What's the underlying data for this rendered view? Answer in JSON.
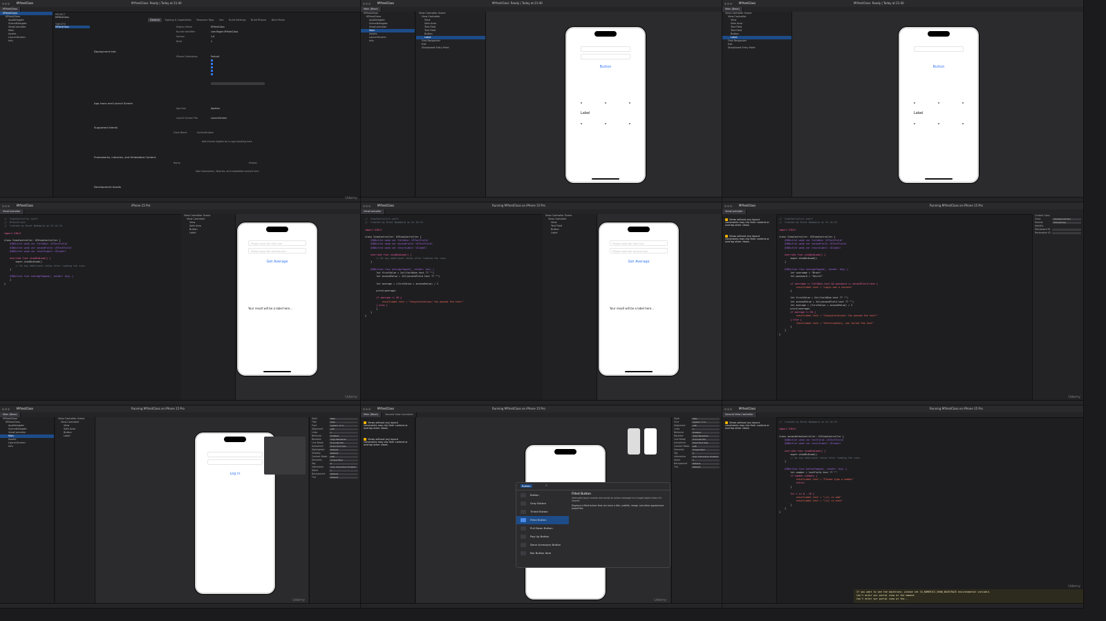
{
  "project": "MYtestClass",
  "watermark": "Udemy",
  "toolbar": {
    "title": "MYtestClass",
    "scheme": "MYtestClass",
    "device": "iPhone 15 Pro",
    "status_ready": "MYtestClass: Ready | Today at 21:40",
    "status_running": "Running MYtestClass on iPhone 15 Pro"
  },
  "navigator": {
    "items": [
      "MYtestClass",
      "MYtestClass",
      "AppDelegate",
      "SceneDelegate",
      "ViewController",
      "Main",
      "Assets",
      "LaunchScreen",
      "Info"
    ]
  },
  "storyboard_outline": {
    "items": [
      "View Controller Scene",
      "View Controller",
      "View",
      "Safe Area",
      "Text Field",
      "Text Field",
      "Button",
      "Label",
      "First Responder",
      "Exit",
      "Storyboard Entry Point"
    ]
  },
  "tabs": {
    "general": [
      "General",
      "Signing & Capabilities",
      "Resource Tags",
      "Info",
      "Build Settings",
      "Build Phases",
      "Build Rules"
    ],
    "editor": [
      "Main (Base)",
      "ViewController",
      "Second View Controller"
    ]
  },
  "settings": {
    "sections": [
      "Deployment Info",
      "App Icons and Launch Screen",
      "Supported Intents",
      "Frameworks, Libraries, and Embedded Content",
      "Development Assets"
    ],
    "rows": [
      {
        "label": "Display Name",
        "value": "MYtestClass"
      },
      {
        "label": "Bundle Identifier",
        "value": "com.Rogen.MYtestClass"
      },
      {
        "label": "Version",
        "value": "1.0"
      },
      {
        "label": "Build",
        "value": "1"
      },
      {
        "label": "iPhone Orientation",
        "value": "Portrait"
      },
      {
        "label": "App Icon",
        "value": "AppIcon"
      },
      {
        "label": "Launch Screen File",
        "value": "LaunchScreen"
      },
      {
        "label": "Class Name",
        "value": "Authentication"
      }
    ],
    "empty_intents": "Add intents eligible for in-app handling here",
    "empty_frameworks": "Add frameworks, libraries, and embedded content here",
    "project_label": "PROJECT",
    "targets_label": "TARGETS",
    "name_label": "Name",
    "embed_label": "Embed"
  },
  "phones": {
    "button": "Button",
    "label": "Label",
    "get_average": "Get Average",
    "login": "Log in",
    "tf1": "Please input the first num",
    "tf2": "Please input the second num",
    "result": "Your result will be a label here..."
  },
  "code": {
    "header1": "//  ViewController.swift",
    "header2": "//  MYtestClass",
    "header3": "//  Created by Brent Wadamula on 01.10.23.",
    "import": "import UIKit",
    "class_decl": "class ViewController: UIViewController {",
    "outlet1": "@IBOutlet weak var fieldOne: UITextField!",
    "outlet2": "@IBOutlet weak var secondField: UITextField!",
    "outlet3": "@IBOutlet weak var resultLabel: UILabel!",
    "vdl": "override func viewDidLoad() {",
    "super": "super.viewDidLoad()",
    "comment": "// Do any additional setup after loading the view.",
    "action": "@IBAction func averageTapped(_ sender: Any) {",
    "let1": "let firstValue = Int(fieldOne.text ?? \"\")",
    "let2": "let secondValue = Int(secondField.text ?? \"\")",
    "avg": "let average = (firstValue + secondValue) / 2",
    "print": "print(average)",
    "if": "if average >= 50 {",
    "cong": "resultLabel.text = \"Congratulations! You passed the test!\"",
    "else": "} else {",
    "fail": "resultLabel.text = \"Unfortunately, you failed the test\"",
    "close": "}"
  },
  "code2": {
    "user": "let username = \"Brent\"",
    "pass": "let password = \"Secret\"",
    "cond": "if username == fieldOne.text && password == secondField.text {",
    "ok": "resultLabel.text = \"Login was a success\""
  },
  "code3": {
    "class_decl": "class secondViewController: UIViewController {",
    "outlet1": "@IBOutlet weak var textField: UITextField!",
    "outlet2": "@IBOutlet weak var resultLabel: UILabel!",
    "action": "@IBAction func buttonTapped(_ sender: Any) {",
    "number": "let number = textField.text ?? \"\"",
    "ifnum": "if number.isEmpty {",
    "err": "resultLabel.text = \"Please type a number\"",
    "return": "return",
    "loop": "for i in 0...10 {",
    "odd": "resultLabel.text = \"\\(i) is odd\"",
    "even": "resultLabel.text = \"\\(i) is even\""
  },
  "warnings": [
    "Views without any layout constraints may clip their content or overlap other views.",
    "Views without any layout constraints may clip their content or overlap other views.",
    "Views without any layout constraints may clip their content or overlap other views.",
    "Views without any layout constraints may clip their content or overlap other views."
  ],
  "library": {
    "search": "Button",
    "items": [
      "Button",
      "Gray Button",
      "Tinted Button",
      "Filled Button",
      "Pull Down Button",
      "Pop Up Button",
      "Done Accessory Button",
      "Bar Button Item"
    ],
    "detail_title": "Filled Button",
    "detail_sub": "Intercepts touch events and sends an action message to a target object when it's tapped.",
    "detail_desc": "Displays a filled button that can have a title, subtitle, image, and other appearance properties."
  },
  "inspector": {
    "rows": [
      {
        "label": "Style",
        "value": "Plain"
      },
      {
        "label": "Title",
        "value": "Plain"
      },
      {
        "label": "Font",
        "value": "System 17.0"
      },
      {
        "label": "Alignment",
        "value": "Left"
      },
      {
        "label": "Lines",
        "value": "1"
      },
      {
        "label": "Behavior",
        "value": "Enabled"
      },
      {
        "label": "Baseline",
        "value": "Align Baselines"
      },
      {
        "label": "Line Break",
        "value": "Truncate Tail"
      },
      {
        "label": "Autoshrink",
        "value": "Fixed Font Size"
      },
      {
        "label": "Highlighted",
        "value": "Default"
      },
      {
        "label": "Shadow",
        "value": "Default"
      },
      {
        "label": "Content Mode",
        "value": "Left"
      },
      {
        "label": "Semantic",
        "value": "Unspecified"
      },
      {
        "label": "Tag",
        "value": "0"
      },
      {
        "label": "Interaction",
        "value": "User Interaction Enabled"
      },
      {
        "label": "Alpha",
        "value": "1"
      },
      {
        "label": "Background",
        "value": "Default"
      },
      {
        "label": "Tint",
        "value": "Default"
      }
    ],
    "identity": [
      "Custom Class",
      "Class",
      "UIViewController",
      "Module",
      "MYtestClass",
      "Identity",
      "Storyboard ID",
      "Restoration ID"
    ]
  },
  "console_text": "If you want to see the backtrace, please set CG_NUMERICS_SHOW_BACKTRACE environmental variable.\nCan't enter our portal view at the moment.\nCan't enter our portal view at the..."
}
